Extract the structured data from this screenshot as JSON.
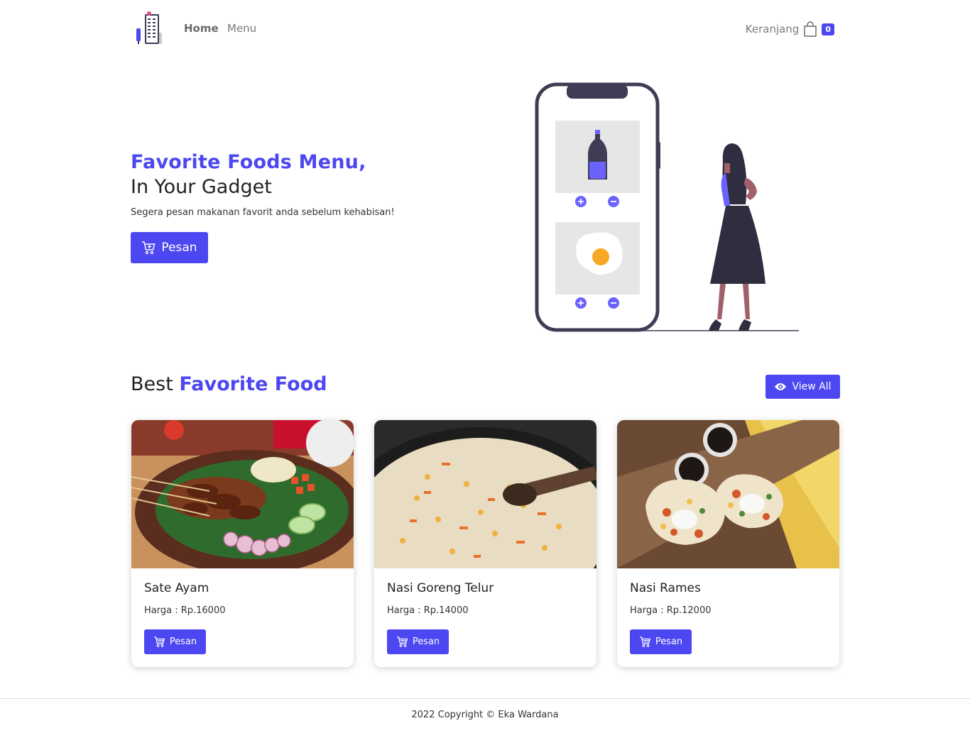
{
  "brand": {
    "logo_icon": "building-logo-icon"
  },
  "nav": {
    "home": "Home",
    "menu": "Menu",
    "cart_label": "Keranjang",
    "cart_icon": "shopping-bag-icon",
    "cart_count": "0"
  },
  "hero": {
    "title_line1": "Favorite Foods Menu,",
    "title_line2": "In Your Gadget",
    "subtitle": "Segera pesan makanan favorit anda sebelum kehabisan!",
    "button_label": "Pesan",
    "button_icon": "cart-plus-icon",
    "illustration": "phone-ordering-illustration"
  },
  "section": {
    "title_plain": "Best",
    "title_accent": "Favorite Food",
    "view_all_label": "View All",
    "view_all_icon": "eye-icon"
  },
  "products": [
    {
      "name": "Sate Ayam",
      "price": "Harga : Rp.16000",
      "button": "Pesan"
    },
    {
      "name": "Nasi Goreng Telur",
      "price": "Harga : Rp.14000",
      "button": "Pesan"
    },
    {
      "name": "Nasi Rames",
      "price": "Harga : Rp.12000",
      "button": "Pesan"
    }
  ],
  "footer": {
    "text": "2022 Copyright © Eka Wardana"
  },
  "colors": {
    "accent": "#4c47f0",
    "text": "#222222",
    "muted": "#7a7a7a"
  }
}
